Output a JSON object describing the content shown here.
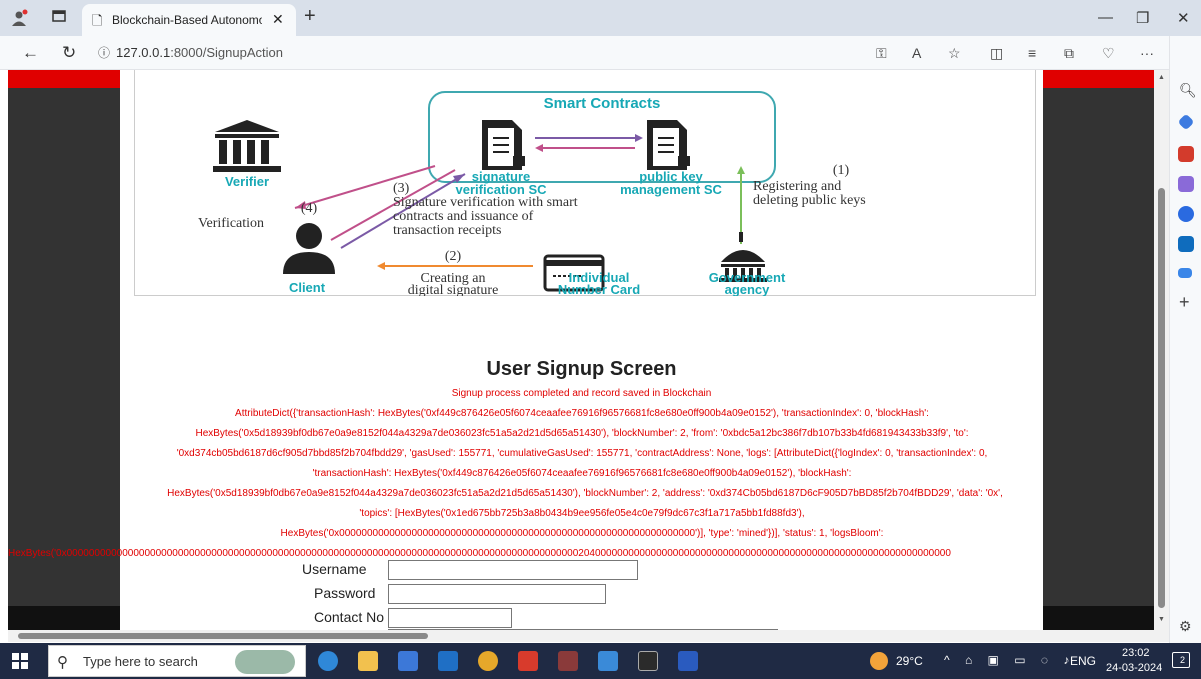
{
  "browser": {
    "tab_title": "Blockchain-Based Autonomous I",
    "url_prefix": "127.0.0.1",
    "url_rest": ":8000/SignupAction"
  },
  "figure": {
    "smart_contracts": "Smart Contracts",
    "sc1_line1": "signature",
    "sc1_line2": "verification SC",
    "sc2_line1": "public key",
    "sc2_line2": "management SC",
    "verifier": "Verifier",
    "client": "Client",
    "card_line1": "Individual",
    "card_line2": "Number Card",
    "gov_line1": "Government",
    "gov_line2": "agency",
    "step1": "(1)",
    "step1_line1": "Registering and",
    "step1_line2": "deleting public keys",
    "step2": "(2)",
    "step2_line1": "Creating an",
    "step2_line2": "digital signature",
    "step3": "(3)",
    "step3_line1": "Signature verification with smart",
    "step3_line2": "contracts and issuance of",
    "step3_line3": "transaction receipts",
    "step4": "(4)",
    "verification": "Verification"
  },
  "main": {
    "heading": "User Signup Screen",
    "status": "Signup process completed and record saved in Blockchain",
    "receipt_lines": [
      "AttributeDict({'transactionHash': HexBytes('0xf449c876426e05f6074ceaafee76916f96576681fc8e680e0ff900b4a09e0152'), 'transactionIndex': 0, 'blockHash':",
      "HexBytes('0x5d18939bf0db67e0a9e8152f044a4329a7de036023fc51a5a2d21d5d65a51430'), 'blockNumber': 2, 'from': '0xbdc5a12bc386f7db107b33b4fd681943433b33f9', 'to':",
      "'0xd374cb05bd6187d6cf905d7bbd85f2b704fbdd29', 'gasUsed': 155771, 'cumulativeGasUsed': 155771, 'contractAddress': None, 'logs': [AttributeDict({'logIndex': 0, 'transactionIndex': 0,",
      "'transactionHash': HexBytes('0xf449c876426e05f6074ceaafee76916f96576681fc8e680e0ff900b4a09e0152'), 'blockHash':",
      "HexBytes('0x5d18939bf0db67e0a9e8152f044a4329a7de036023fc51a5a2d21d5d65a51430'), 'blockNumber': 2, 'address': '0xd374Cb05bd6187D6cF905D7bBD85f2b704fBDD29', 'data': '0x',",
      "'topics': [HexBytes('0x1ed675bb725b3a8b0434b9ee956fe05e4c0e79f9dc67c3f1a717a5bb1fd88fd3'),",
      "HexBytes('0x0000000000000000000000000000000000000000000000000000000000000000')], 'type': 'mined'})], 'status': 1, 'logsBloom':",
      "HexBytes('0x000000000000000000000000000000000000000000000000000000000000000000000000000000000000000000002040000000000000000000000000000000000000000000000000000000000000000"
    ],
    "username_label": "Username",
    "password_label": "Password",
    "contact_label": "Contact No"
  },
  "taskbar": {
    "search_placeholder": "Type here to search",
    "weather": "29°C",
    "lang": "ENG",
    "time": "23:02",
    "date": "24-03-2024",
    "notif_count": "2"
  },
  "colors": {
    "accent_red": "#e00000",
    "teal": "#17a8b5",
    "taskbar": "#1f2a44"
  }
}
